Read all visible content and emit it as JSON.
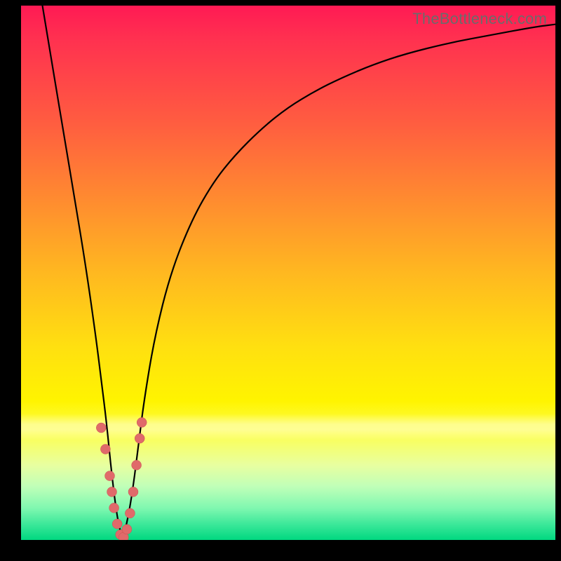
{
  "watermark": "TheBottleneck.com",
  "chart_data": {
    "type": "line",
    "title": "",
    "xlabel": "",
    "ylabel": "",
    "xlim": [
      0,
      100
    ],
    "ylim": [
      0,
      100
    ],
    "grid": false,
    "series": [
      {
        "name": "bottleneck-curve",
        "x": [
          4,
          6,
          8,
          10,
          12,
          14,
          15,
          16,
          17,
          18,
          19,
          20,
          21,
          22,
          23,
          25,
          28,
          32,
          36,
          40,
          45,
          50,
          55,
          60,
          66,
          72,
          80,
          88,
          96,
          100
        ],
        "y": [
          100,
          88,
          76,
          64,
          52,
          38,
          30,
          22,
          12,
          4,
          0,
          4,
          10,
          18,
          26,
          38,
          50,
          60,
          67,
          72,
          77,
          81,
          84,
          86.5,
          89,
          91,
          93,
          94.5,
          96,
          96.5
        ]
      }
    ],
    "markers": {
      "name": "highlight-points",
      "points": [
        {
          "x": 15.0,
          "y": 21
        },
        {
          "x": 15.8,
          "y": 17
        },
        {
          "x": 16.6,
          "y": 12
        },
        {
          "x": 17.0,
          "y": 9
        },
        {
          "x": 17.4,
          "y": 6
        },
        {
          "x": 18.0,
          "y": 3
        },
        {
          "x": 18.6,
          "y": 1
        },
        {
          "x": 19.2,
          "y": 0.5
        },
        {
          "x": 19.8,
          "y": 2
        },
        {
          "x": 20.4,
          "y": 5
        },
        {
          "x": 21.0,
          "y": 9
        },
        {
          "x": 21.6,
          "y": 14
        },
        {
          "x": 22.2,
          "y": 19
        },
        {
          "x": 22.6,
          "y": 22
        }
      ]
    }
  }
}
